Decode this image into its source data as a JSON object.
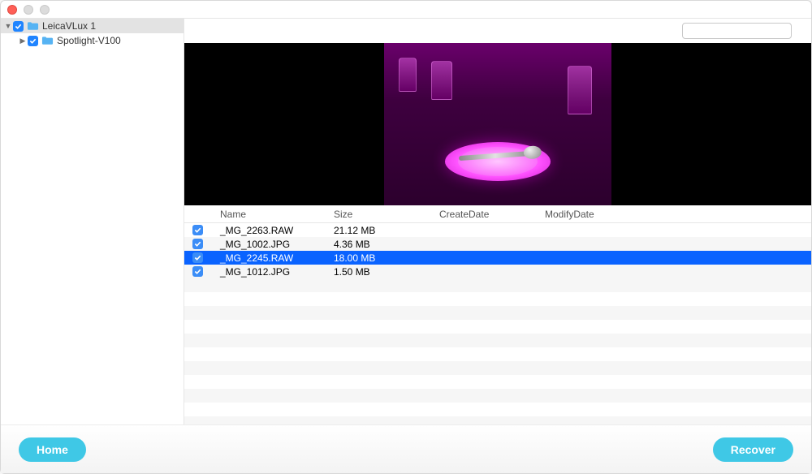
{
  "search": {
    "placeholder": ""
  },
  "sidebar": {
    "items": [
      {
        "label": "LeicaVLux 1",
        "expanded": true,
        "checked": true
      },
      {
        "label": "Spotlight-V100",
        "expanded": false,
        "checked": true
      }
    ]
  },
  "columns": {
    "name": "Name",
    "size": "Size",
    "createDate": "CreateDate",
    "modifyDate": "ModifyDate"
  },
  "files": [
    {
      "checked": true,
      "name": "_MG_2263.RAW",
      "size": "21.12 MB",
      "createDate": "",
      "modifyDate": "",
      "selected": false
    },
    {
      "checked": true,
      "name": "_MG_1002.JPG",
      "size": "4.36 MB",
      "createDate": "",
      "modifyDate": "",
      "selected": false
    },
    {
      "checked": true,
      "name": "_MG_2245.RAW",
      "size": "18.00 MB",
      "createDate": "",
      "modifyDate": "",
      "selected": true
    },
    {
      "checked": true,
      "name": "_MG_1012.JPG",
      "size": "1.50 MB",
      "createDate": "",
      "modifyDate": "",
      "selected": false
    }
  ],
  "footer": {
    "home": "Home",
    "recover": "Recover"
  }
}
